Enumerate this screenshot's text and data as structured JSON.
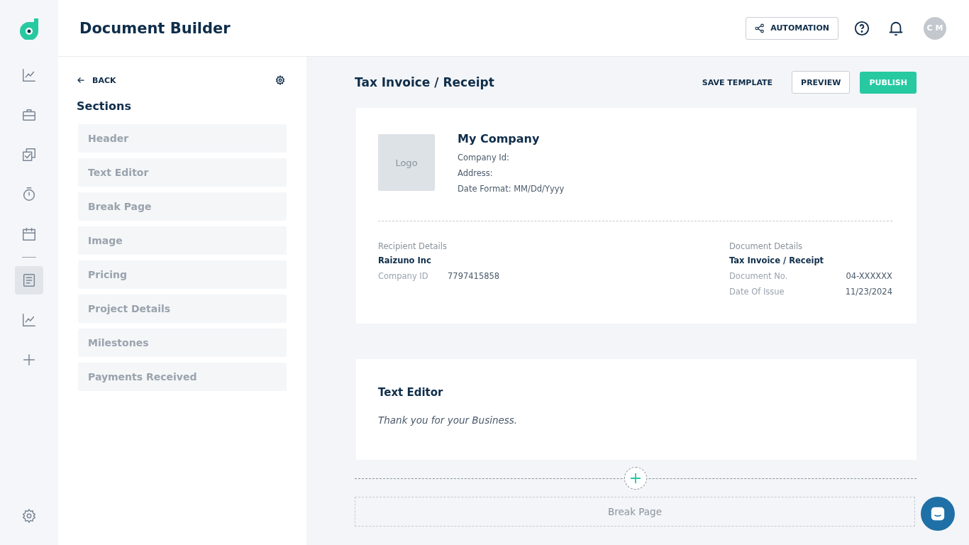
{
  "app": {
    "title": "Document Builder"
  },
  "nav": [
    {
      "selected": false
    },
    {
      "selected": false
    },
    {
      "selected": false
    },
    {
      "selected": false
    },
    {
      "selected": false
    },
    {
      "selected": true
    },
    {
      "selected": false
    },
    {
      "selected": false
    }
  ],
  "topbar": {
    "automation": "AUTOMATION",
    "avatar": "C M"
  },
  "panel": {
    "back": "BACK",
    "heading": "Sections",
    "items": [
      "Header",
      "Text Editor",
      "Break Page",
      "Image",
      "Pricing",
      "Project Details",
      "Milestones",
      "Payments Received"
    ]
  },
  "document": {
    "title": "Tax Invoice / Receipt",
    "actions": {
      "save": "SAVE TEMPLATE",
      "preview": "PREVIEW",
      "publish": "PUBLISH"
    },
    "header": {
      "logo": "Logo",
      "company": "My Company",
      "fields": [
        "Company Id:",
        "Address:",
        "Date Format:  MM/Dd/Yyyy"
      ],
      "recipient": {
        "label": "Recipient Details",
        "name": "Raizuno Inc",
        "rows": [
          {
            "key": "Company ID",
            "value": "7797415858"
          }
        ]
      },
      "details": {
        "label": "Document Details",
        "name": "Tax Invoice / Receipt",
        "rows": [
          {
            "key": "Document No.",
            "value": "04-XXXXXX"
          },
          {
            "key": "Date Of Issue",
            "value": "11/23/2024"
          }
        ]
      }
    },
    "text_section": {
      "title": "Text Editor",
      "body": "Thank you for your Business."
    },
    "break_page": "Break Page"
  }
}
